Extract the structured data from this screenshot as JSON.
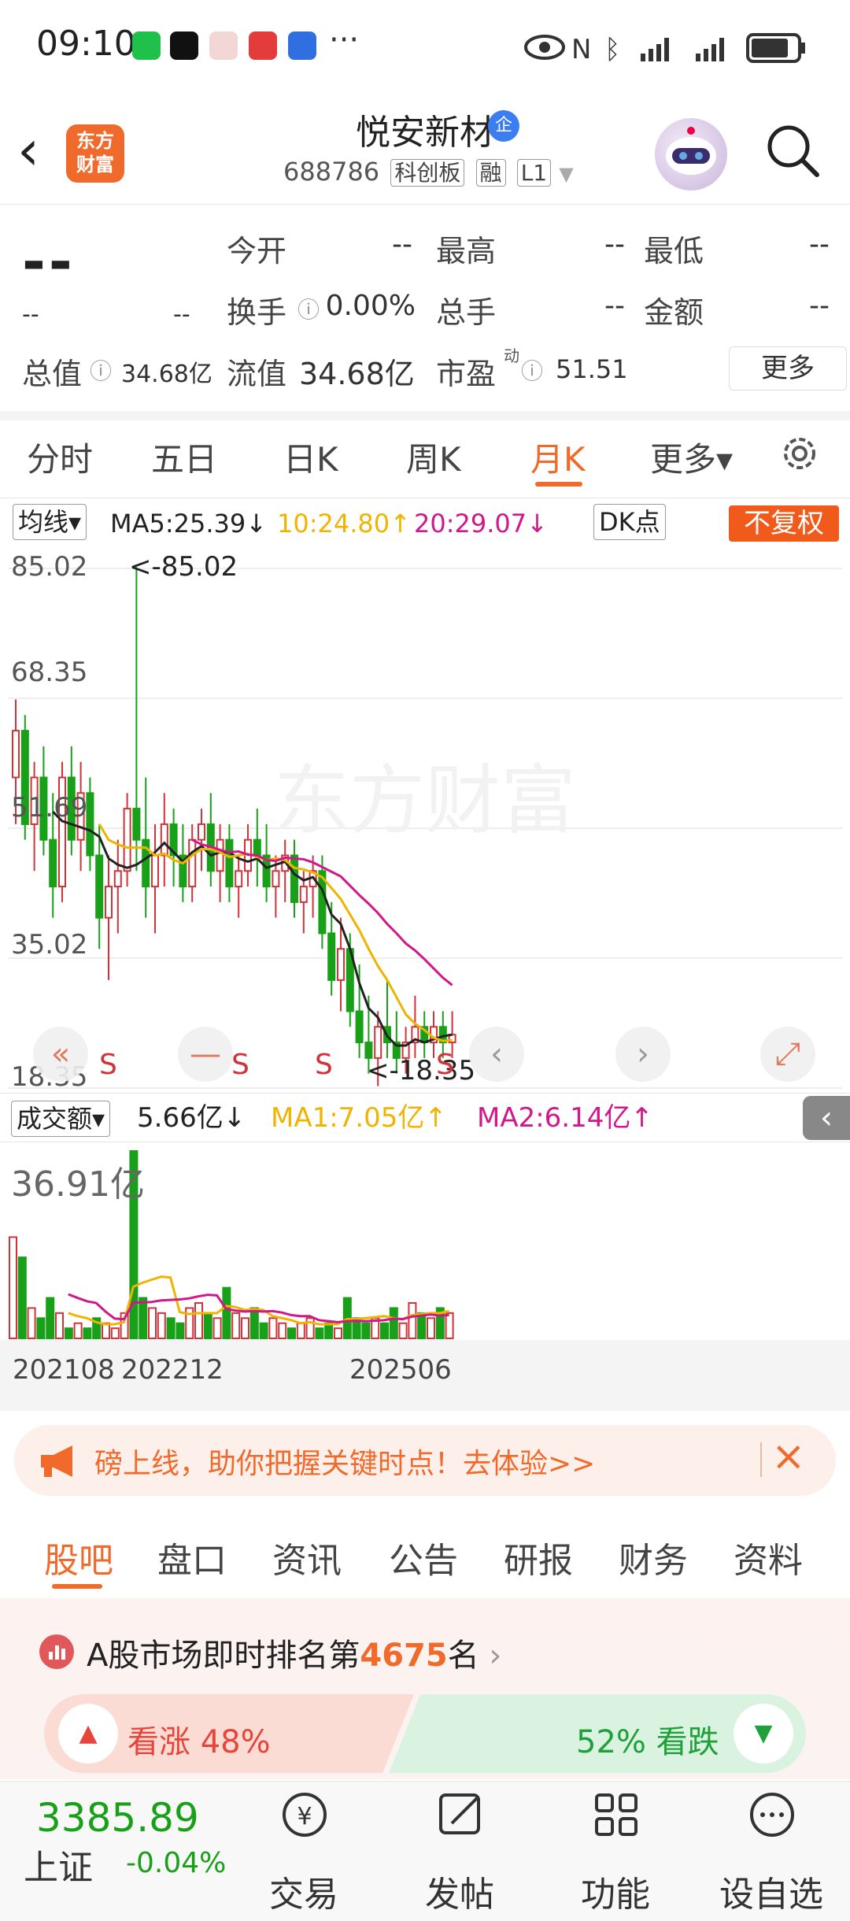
{
  "status_bar": {
    "time": "09:10",
    "more": "···",
    "battery": "battery"
  },
  "header": {
    "back_icon": "chevron-left-icon",
    "logo_text_1": "东方",
    "logo_text_2": "财富",
    "stock_name": "悦安新材",
    "badge": "企",
    "stock_code": "688786",
    "tags": [
      "科创板",
      "融",
      "L1"
    ],
    "search_icon": "search-icon"
  },
  "quote": {
    "price": "--",
    "change": "--",
    "change_pct": "--",
    "fields": [
      {
        "label": "今开",
        "value": "--"
      },
      {
        "label": "最高",
        "value": "--"
      },
      {
        "label": "最低",
        "value": "--"
      },
      {
        "label": "换手",
        "value": "0.00%"
      },
      {
        "label": "总手",
        "value": "--"
      },
      {
        "label": "金额",
        "value": "--"
      }
    ],
    "total_mv_label": "总值",
    "total_mv": "34.68亿",
    "float_mv_label": "流值",
    "float_mv": "34.68亿",
    "pe_label": "市盈",
    "pe_sup": "动",
    "pe": "51.51",
    "more": "更多"
  },
  "period_tabs": [
    "分时",
    "五日",
    "日K",
    "周K",
    "月K",
    "更多▾"
  ],
  "active_period": "月K",
  "ma_bar": {
    "selector": "均线▾",
    "ma5": "MA5:25.39↓",
    "ma10": "10:24.80↑",
    "ma20": "20:29.07↓",
    "dk": "DK点",
    "nofq": "不复权"
  },
  "colors": {
    "up": "#d0333a",
    "down": "#18a018",
    "ma5": "#222222",
    "ma10": "#f0b400",
    "ma20": "#d0188c",
    "accent": "#f06a2b"
  },
  "chart_data": {
    "type": "candlestick",
    "y_ticks": [
      "85.02",
      "68.35",
      "51.69",
      "35.02",
      "18.35"
    ],
    "ylim": [
      18.35,
      85.02
    ],
    "max_label": "<-85.02",
    "min_label": "<-18.35",
    "signals": [
      "S",
      "S",
      "S",
      "S"
    ],
    "candles": [
      [
        58,
        68,
        52,
        64
      ],
      [
        64,
        66,
        50,
        52
      ],
      [
        52,
        60,
        46,
        58
      ],
      [
        58,
        62,
        48,
        50
      ],
      [
        50,
        56,
        40,
        44
      ],
      [
        44,
        60,
        42,
        58
      ],
      [
        58,
        62,
        48,
        50
      ],
      [
        50,
        60,
        46,
        56
      ],
      [
        56,
        58,
        46,
        48
      ],
      [
        48,
        52,
        36,
        40
      ],
      [
        40,
        48,
        32,
        44
      ],
      [
        44,
        50,
        38,
        46
      ],
      [
        46,
        56,
        44,
        54
      ],
      [
        54,
        85,
        46,
        50
      ],
      [
        50,
        58,
        40,
        44
      ],
      [
        44,
        52,
        38,
        48
      ],
      [
        48,
        56,
        44,
        52
      ],
      [
        52,
        54,
        44,
        48
      ],
      [
        48,
        52,
        42,
        44
      ],
      [
        44,
        52,
        42,
        50
      ],
      [
        50,
        54,
        46,
        52
      ],
      [
        52,
        56,
        44,
        46
      ],
      [
        46,
        52,
        42,
        50
      ],
      [
        50,
        52,
        42,
        44
      ],
      [
        44,
        48,
        40,
        46
      ],
      [
        46,
        52,
        44,
        50
      ],
      [
        50,
        54,
        44,
        48
      ],
      [
        48,
        52,
        42,
        44
      ],
      [
        44,
        48,
        40,
        46
      ],
      [
        46,
        50,
        42,
        48
      ],
      [
        48,
        50,
        40,
        42
      ],
      [
        42,
        46,
        38,
        44
      ],
      [
        44,
        48,
        40,
        46
      ],
      [
        46,
        48,
        36,
        38
      ],
      [
        38,
        42,
        30,
        32
      ],
      [
        32,
        40,
        28,
        36
      ],
      [
        36,
        38,
        26,
        28
      ],
      [
        28,
        34,
        22,
        24
      ],
      [
        24,
        30,
        20,
        22
      ],
      [
        22,
        28,
        18.4,
        26
      ],
      [
        26,
        32,
        22,
        24
      ],
      [
        24,
        28,
        20,
        22
      ],
      [
        22,
        26,
        20,
        24
      ],
      [
        24,
        30,
        22,
        26
      ],
      [
        26,
        28,
        22,
        24
      ],
      [
        24,
        28,
        22,
        26
      ],
      [
        26,
        28,
        22,
        24
      ],
      [
        24,
        28,
        22,
        25
      ]
    ]
  },
  "volume": {
    "selector": "成交额▾",
    "value": "5.66亿↓",
    "ma1": "MA1:7.05亿↑",
    "ma2": "MA2:6.14亿↑",
    "max_label": "36.91亿",
    "x_labels": [
      "202108",
      "202212",
      "202506"
    ],
    "values": [
      20,
      16,
      6,
      4,
      8,
      5,
      2,
      3,
      2,
      4,
      3,
      2,
      5,
      37,
      8,
      6,
      5,
      4,
      3,
      6,
      7,
      5,
      4,
      10,
      5,
      4,
      6,
      3,
      4,
      3,
      2,
      3,
      4,
      2,
      3,
      2,
      8,
      4,
      3,
      4,
      3,
      6,
      3,
      7,
      5,
      4,
      6,
      5
    ]
  },
  "banner": {
    "text": "磅上线，助你把握关键时点！去体验>>"
  },
  "content_tabs": [
    "股吧",
    "盘口",
    "资讯",
    "公告",
    "研报",
    "财务",
    "资料"
  ],
  "active_content_tab": "股吧",
  "rank": {
    "prefix": "A股市场即时排名第",
    "number": "4675",
    "suffix": "名"
  },
  "vote": {
    "up": "看涨 48%",
    "down": "52% 看跌"
  },
  "bottom_nav": {
    "index_value": "3385.89",
    "index_name": "上证",
    "index_change": "-0.04%",
    "items": [
      "交易",
      "发帖",
      "功能",
      "设自选"
    ]
  }
}
